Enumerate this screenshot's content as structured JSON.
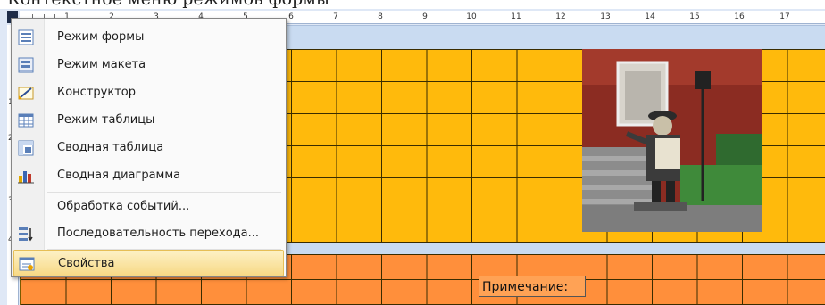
{
  "caption": {
    "text": "Контекстное меню режимов формы"
  },
  "ruler": {
    "marks": [
      "1",
      "2",
      "3",
      "4",
      "5",
      "6",
      "7",
      "8",
      "9",
      "10",
      "11",
      "12",
      "13",
      "14",
      "15",
      "16",
      "17"
    ],
    "vmarks": [
      "1",
      "2",
      "3",
      "4"
    ]
  },
  "context_menu": {
    "items": [
      {
        "label": "Режим формы"
      },
      {
        "label": "Режим макета"
      },
      {
        "label": "Конструктор"
      },
      {
        "label": "Режим таблицы"
      },
      {
        "label": "Сводная таблица"
      },
      {
        "label": "Сводная диаграмма"
      },
      {
        "label": "Обработка событий..."
      },
      {
        "label": "Последовательность перехода..."
      },
      {
        "label": "Свойства"
      }
    ]
  },
  "footer": {
    "note_label": "Примечание:"
  },
  "colors": {
    "detail": "#ffba0c",
    "footer": "#ff8f3b",
    "menu_highlight": "#f7d985"
  }
}
